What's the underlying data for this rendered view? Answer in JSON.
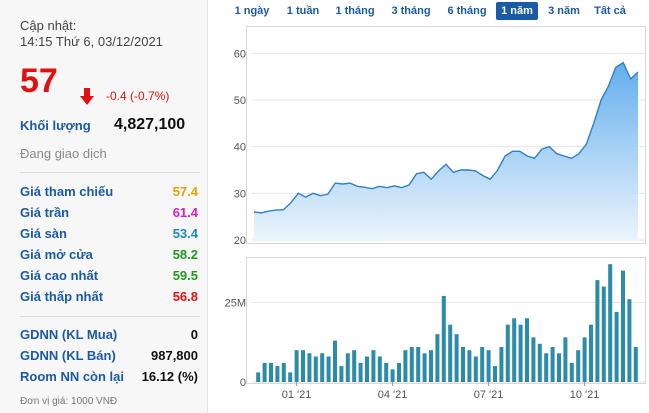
{
  "quote": {
    "updated_label": "Cập nhật:",
    "updated_time": "14:15 Thứ 6, 03/12/2021",
    "price": "57",
    "change": "-0.4 (-0.7%)",
    "volume_label": "Khối lượng",
    "volume_value": "4,827,100",
    "status": "Đang giao dịch",
    "rows": [
      {
        "label": "Giá tham chiếu",
        "value": "57.4",
        "color": "#e8a200"
      },
      {
        "label": "Giá trần",
        "value": "61.4",
        "color": "#d321c8"
      },
      {
        "label": "Giá sàn",
        "value": "53.4",
        "color": "#1a8fb8"
      },
      {
        "label": "Giá mở cửa",
        "value": "58.2",
        "color": "#1f9a1f"
      },
      {
        "label": "Giá cao nhất",
        "value": "59.5",
        "color": "#1f9a1f"
      },
      {
        "label": "Giá thấp nhất",
        "value": "56.8",
        "color": "#e41010"
      }
    ],
    "foreign": [
      {
        "label": "GDNN (KL Mua)",
        "value": "0"
      },
      {
        "label": "GDNN (KL Bán)",
        "value": "987,800"
      },
      {
        "label": "Room NN còn lại",
        "value": "16.12 (%)"
      }
    ],
    "unit_note": "Đơn vị giá: 1000 VNĐ"
  },
  "tabs": [
    {
      "label": "1 ngày",
      "active": false
    },
    {
      "label": "1 tuần",
      "active": false
    },
    {
      "label": "1 tháng",
      "active": false
    },
    {
      "label": "3 tháng",
      "active": false
    },
    {
      "label": "6 tháng",
      "active": false
    },
    {
      "label": "1 năm",
      "active": true
    },
    {
      "label": "3 năm",
      "active": false
    },
    {
      "label": "Tất cả",
      "active": false
    }
  ],
  "colors": {
    "price_line": "#2f7fc9",
    "area_top": "#5aa9ec",
    "area_bottom": "#e9f3fc",
    "bar": "#2a8ca8",
    "down": "#e41010",
    "link": "#1a5aa6"
  },
  "chart_data": [
    {
      "type": "area",
      "ylim": [
        20,
        65
      ],
      "yticks": [
        20,
        30,
        40,
        50,
        60
      ],
      "y_tick_labels": [
        "20",
        "30",
        "40",
        "50",
        "60"
      ],
      "grid": true,
      "values": [
        26,
        25.8,
        26.2,
        26.4,
        26.5,
        28,
        30,
        29.2,
        30,
        29.5,
        29.8,
        32.2,
        32,
        32.2,
        31.5,
        31.3,
        31,
        31.5,
        31.2,
        31.6,
        31.2,
        31.8,
        34.2,
        34.5,
        33,
        34.8,
        36.2,
        34.5,
        35,
        35,
        34.8,
        33.8,
        33,
        35,
        38,
        39,
        39,
        38,
        37.5,
        39.5,
        40,
        38.5,
        38,
        37.5,
        38.5,
        40.5,
        45,
        50,
        53,
        57,
        58,
        54.5,
        56
      ]
    },
    {
      "type": "bar",
      "ylim": [
        0,
        38
      ],
      "yticks": [
        0,
        25
      ],
      "y_tick_labels": [
        "0",
        "25M"
      ],
      "x_tick_labels": [
        "01 '21",
        "04 '21",
        "07 '21",
        "10 '21"
      ],
      "x_tick_index": [
        6,
        21,
        36,
        51
      ],
      "values": [
        3,
        6,
        6,
        5,
        6,
        3,
        10,
        10,
        9,
        8,
        9,
        8,
        13,
        5,
        9,
        10,
        6,
        8,
        10,
        8,
        6,
        4,
        6,
        10,
        11,
        11,
        9,
        10,
        15,
        27,
        18,
        15,
        11,
        10,
        8,
        11,
        10,
        5,
        11,
        18,
        20,
        18,
        20,
        14,
        12,
        9,
        11,
        9,
        14,
        6,
        10,
        14,
        18,
        32,
        30,
        37,
        22,
        35,
        26,
        11
      ]
    }
  ]
}
